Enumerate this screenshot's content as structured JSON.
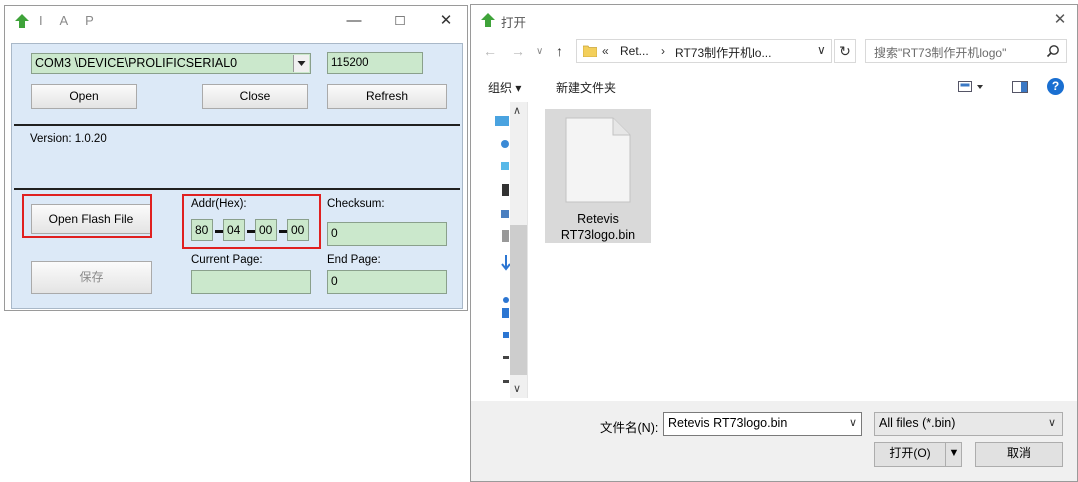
{
  "iap": {
    "title": "I A P",
    "com_port": "COM3  \\DEVICE\\PROLIFICSERIAL0",
    "baud": "115200",
    "open_label": "Open",
    "close_label": "Close",
    "refresh_label": "Refresh",
    "version": "Version:  1.0.20",
    "open_flash_label": "Open   Flash File",
    "addr_label": "Addr(Hex):",
    "addr": [
      "80",
      "04",
      "00",
      "00"
    ],
    "checksum_label": "Checksum:",
    "checksum": "0",
    "save_label": "保存",
    "current_page_label": "Current Page:",
    "current_page": "",
    "end_page_label": "End Page:",
    "end_page": "0"
  },
  "dialog": {
    "title": "打开",
    "breadcrumb": [
      "«",
      "Ret...",
      "RT73制作开机lo..."
    ],
    "search_placeholder": "搜索\"RT73制作开机logo\"",
    "organize_label": "组织 ▾",
    "new_folder_label": "新建文件夹",
    "file_name_line1": "Retevis",
    "file_name_line2": "RT73logo.bin",
    "filename_label": "文件名(N):",
    "filename_value": "Retevis RT73logo.bin",
    "filter_value": "All files (*.bin)",
    "open_label": "打开(O)",
    "cancel_label": "取消"
  },
  "colors": {
    "field_green": "#cbe8cc",
    "panel_blue": "#dce9f7",
    "highlight_red": "#e02020",
    "help_blue": "#1a6fd1"
  },
  "icons": [
    "app-arrow-icon",
    "minimize-icon",
    "maximize-icon",
    "close-icon",
    "back-icon",
    "forward-icon",
    "up-icon",
    "folder-icon",
    "refresh-icon",
    "search-icon",
    "view-icon",
    "pane-icon",
    "help-icon",
    "document-icon",
    "chevron-down-icon"
  ]
}
